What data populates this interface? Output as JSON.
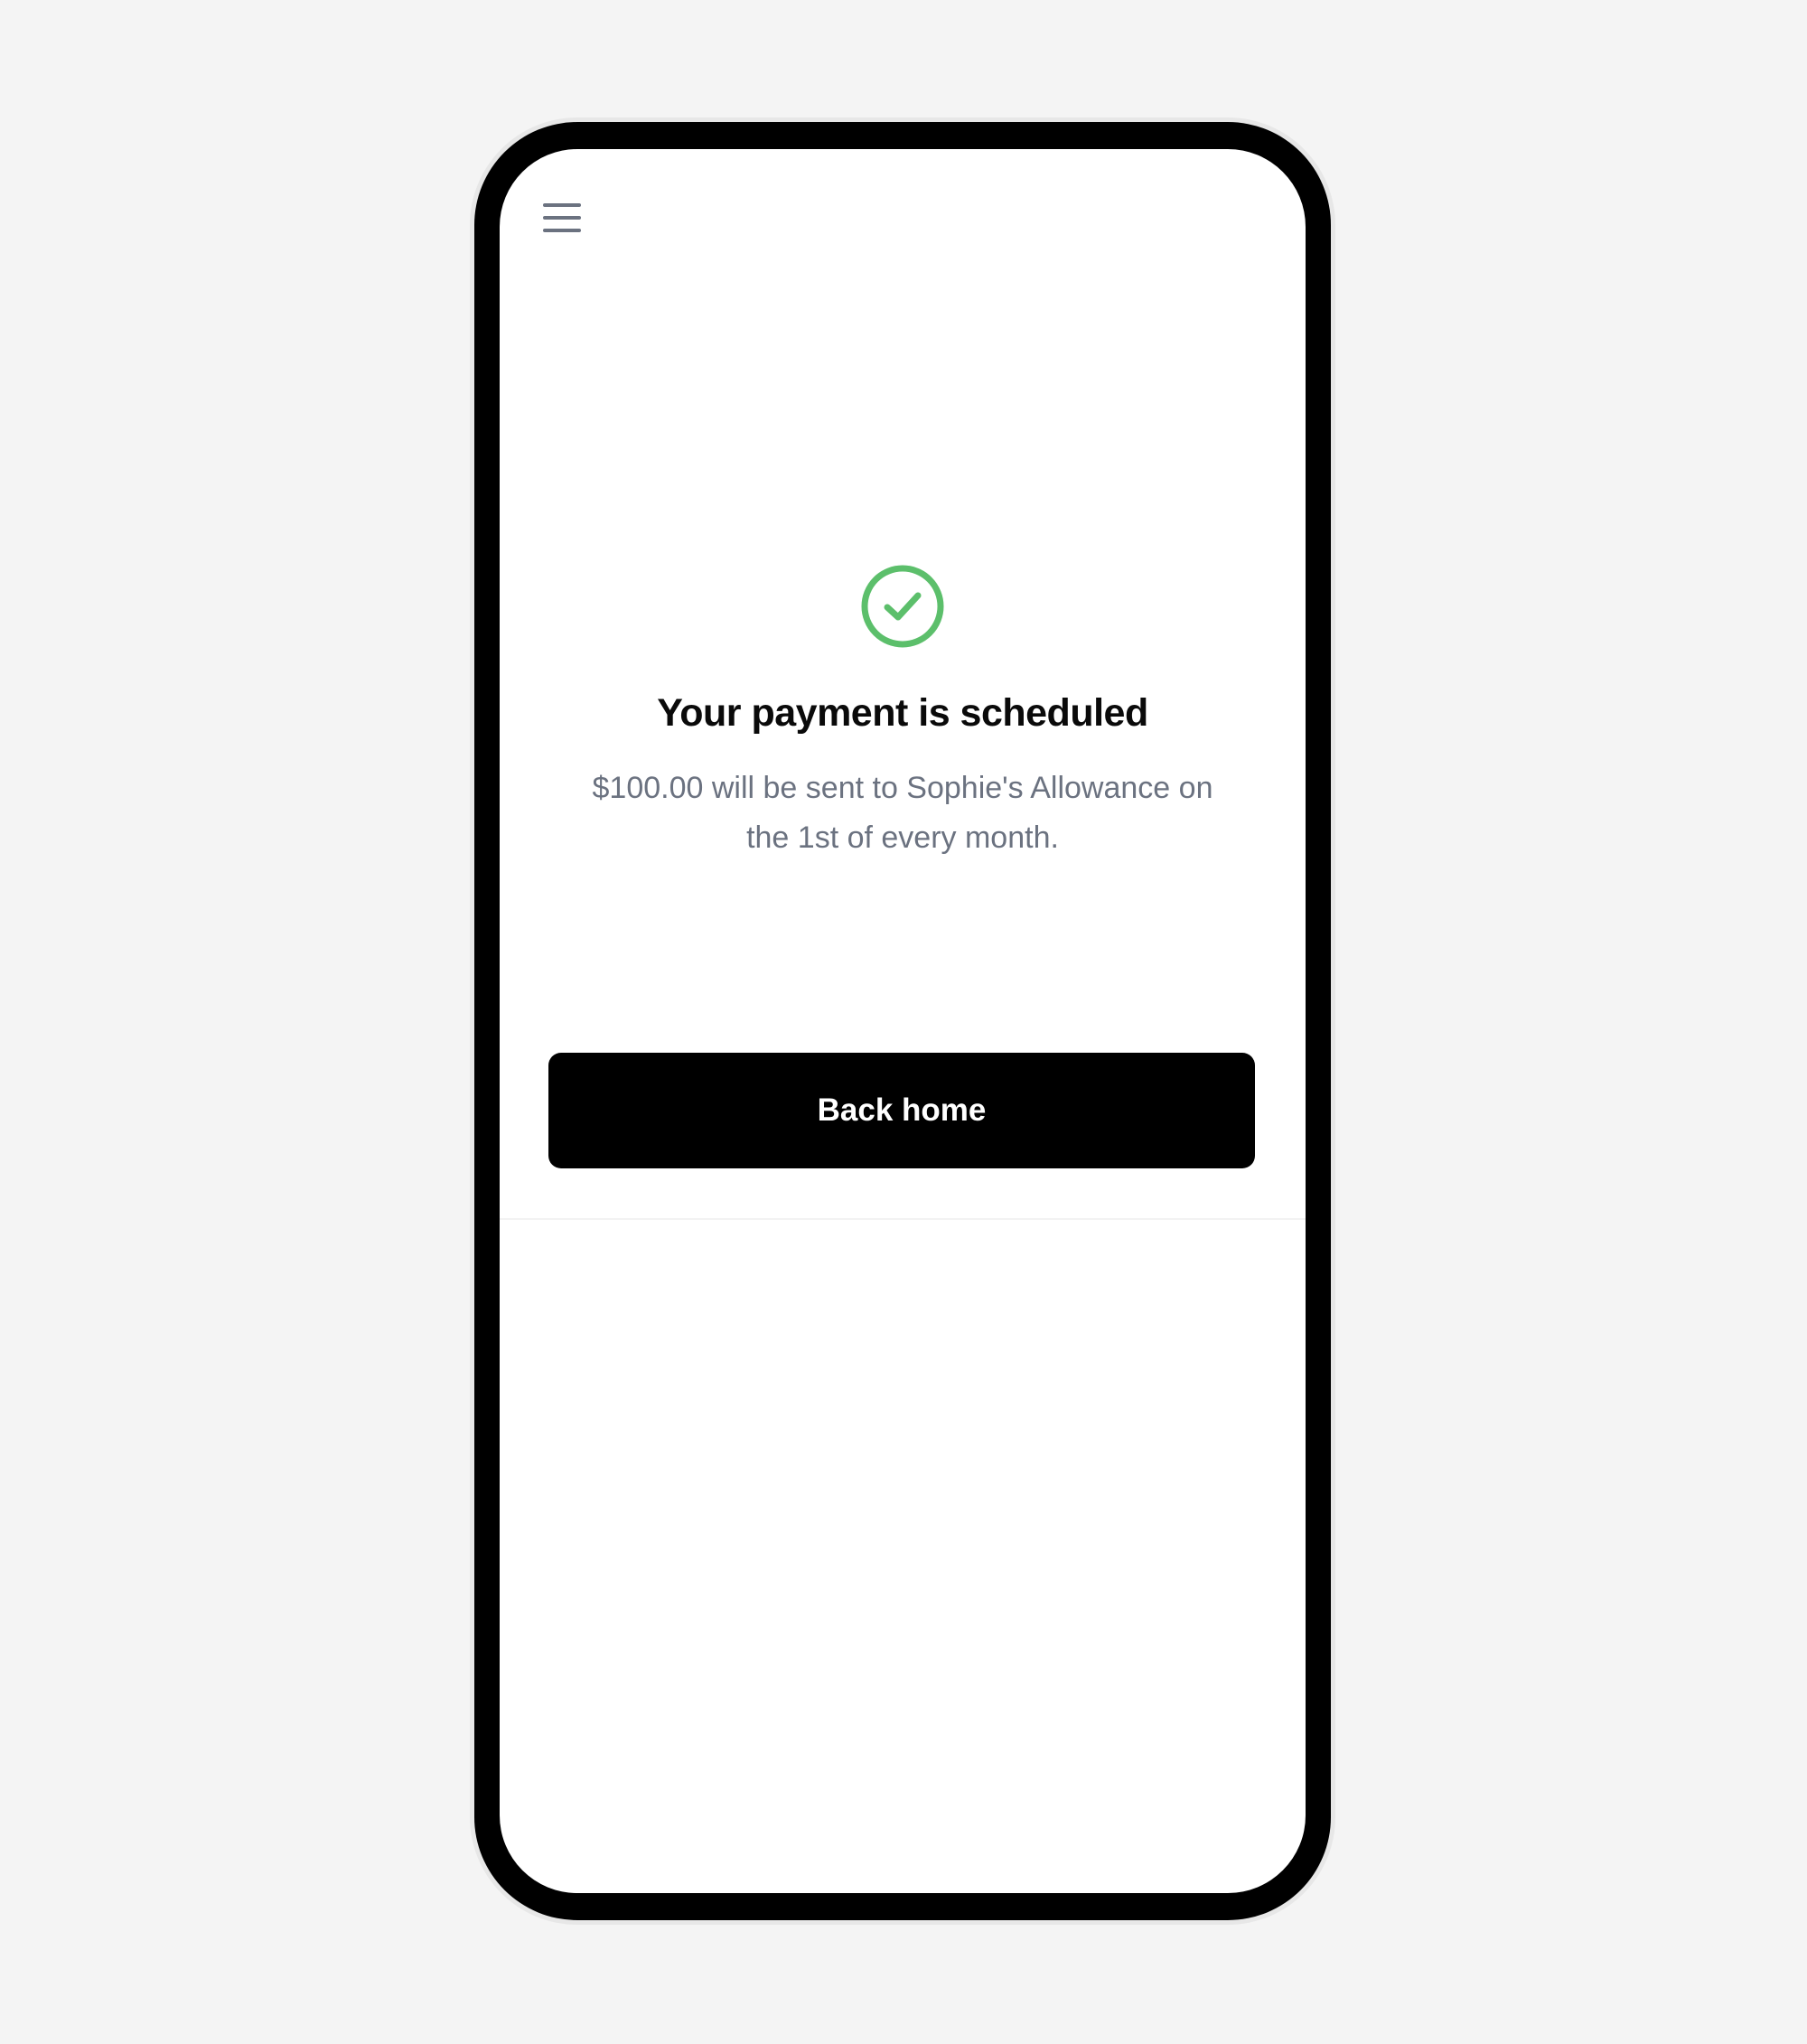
{
  "colors": {
    "accent_success": "#5cbf6b",
    "button_background": "#000000",
    "subtitle_text": "#6b7280"
  },
  "header": {
    "menu_icon": "hamburger-menu-icon"
  },
  "confirmation": {
    "icon": "check-circle-icon",
    "title": "Your payment is scheduled",
    "message_line1": "$100.00 will be sent to Sophie's Allowance on",
    "message_line2": "the 1st of every month."
  },
  "actions": {
    "back_home_label": "Back home"
  }
}
